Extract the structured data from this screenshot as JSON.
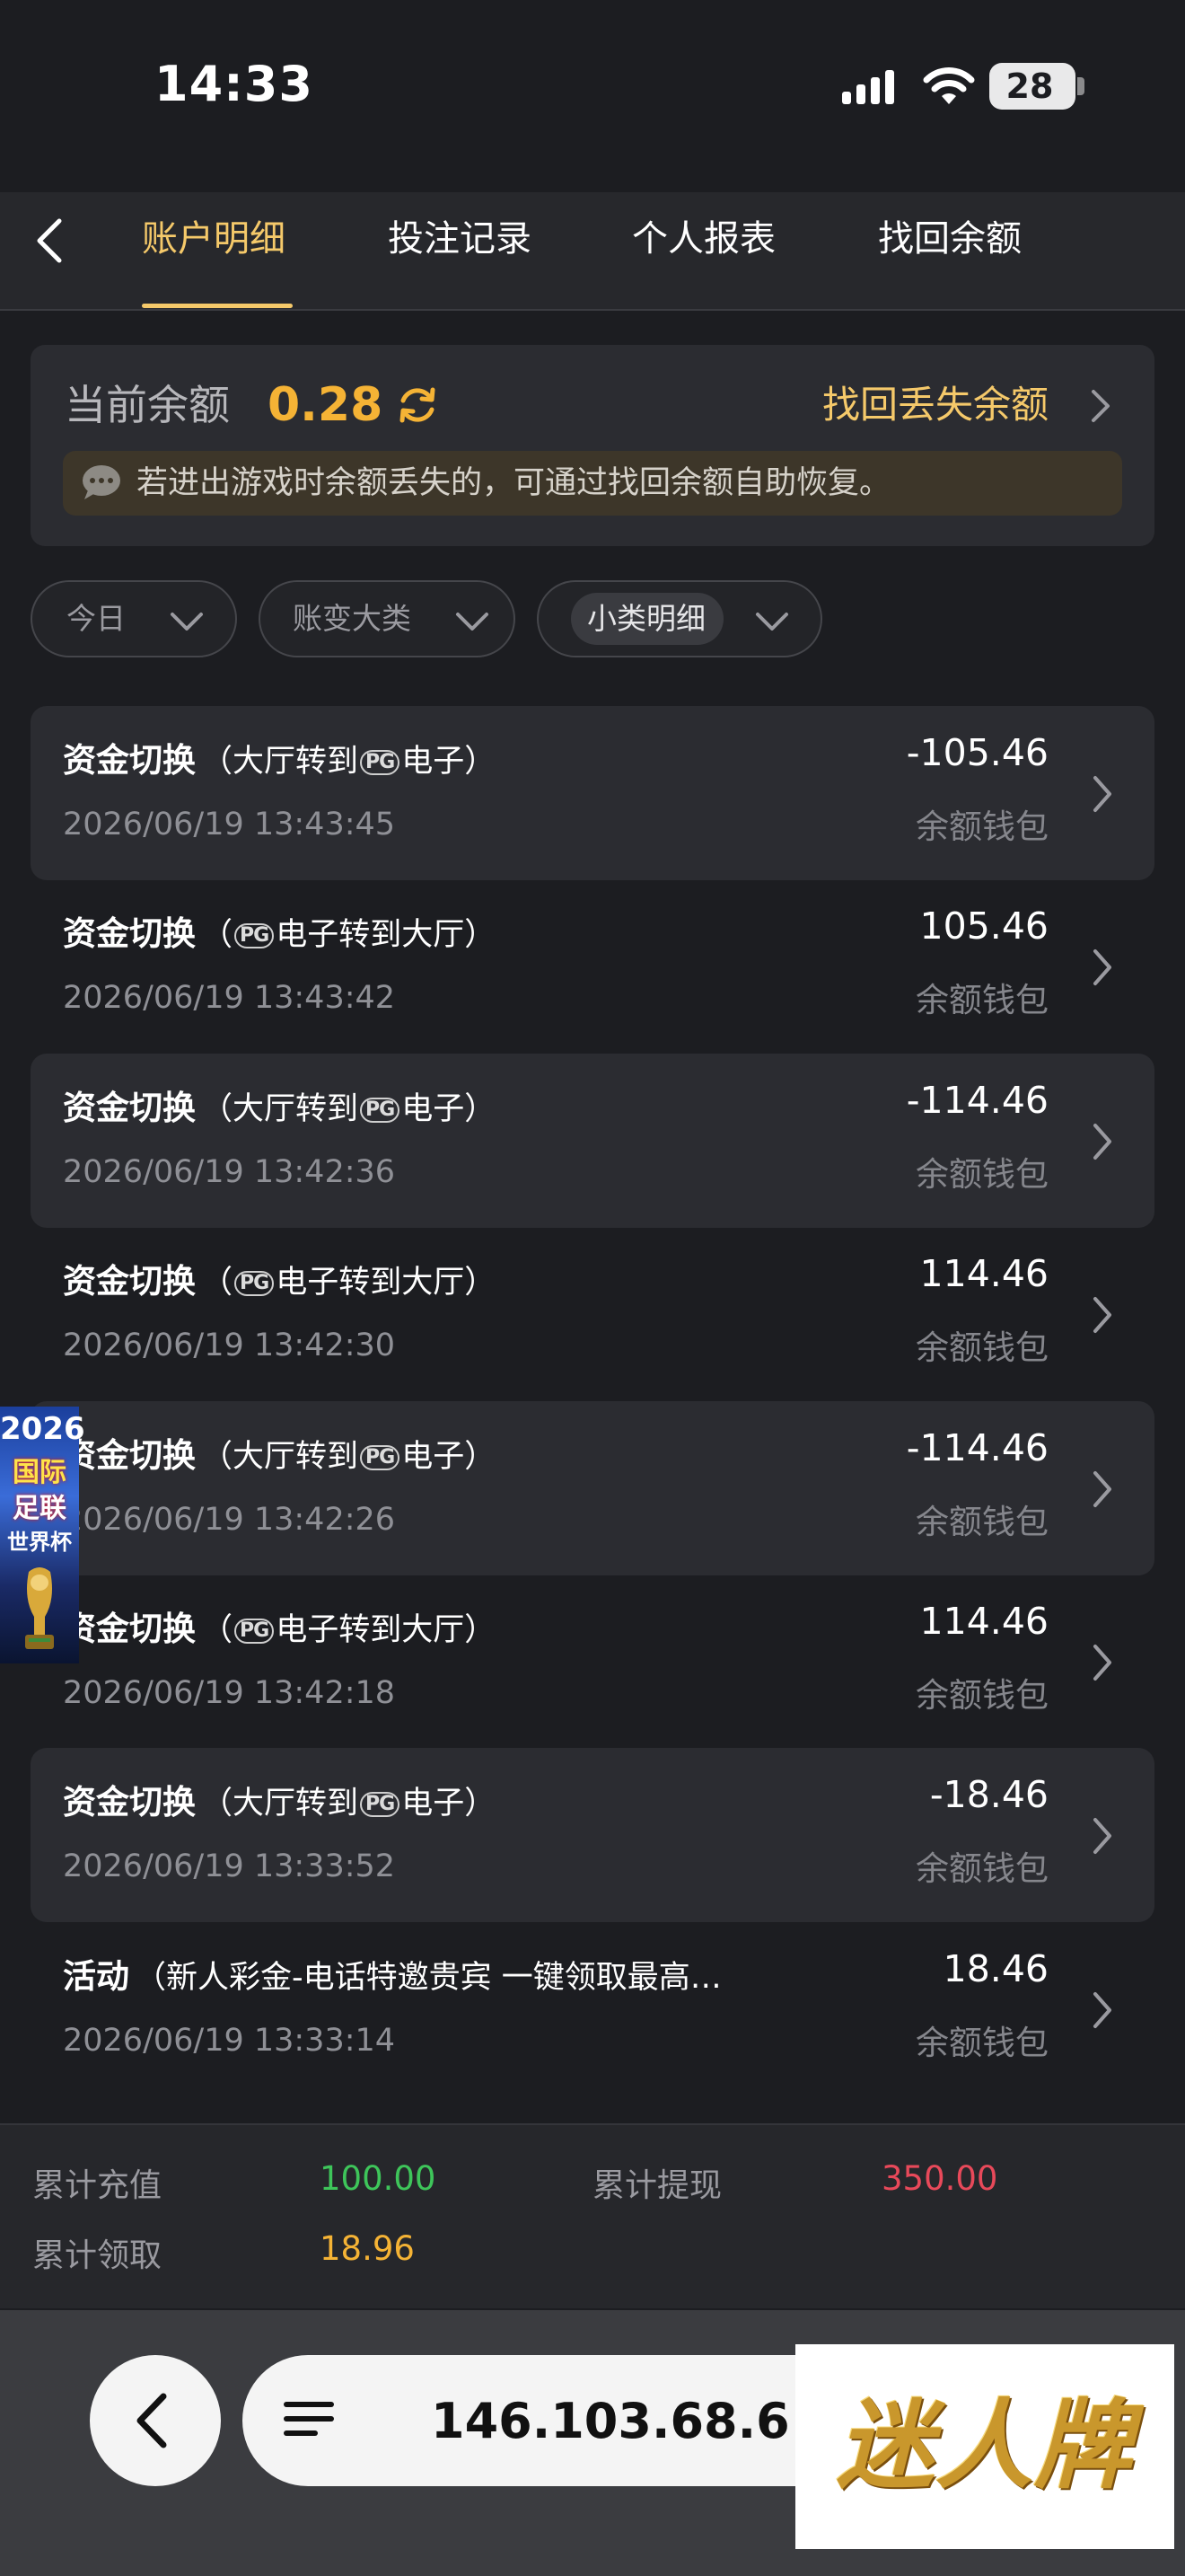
{
  "status_bar": {
    "time": "14:33",
    "battery": "28"
  },
  "nav": {
    "tabs": [
      {
        "label": "账户明细",
        "active": true
      },
      {
        "label": "投注记录",
        "active": false
      },
      {
        "label": "个人报表",
        "active": false
      },
      {
        "label": "找回余额",
        "active": false
      }
    ]
  },
  "balance": {
    "label": "当前余额",
    "value": "0.28",
    "recover_link": "找回丢失余额",
    "notice": "若进出游戏时余额丢失的，可通过找回余额自助恢复。"
  },
  "filters": {
    "date": "今日",
    "category": "账变大类",
    "subcategory": "小类明细"
  },
  "records": [
    {
      "title": "资金切换",
      "desc_pre": "（大厅转到",
      "desc_post": "电子）",
      "pg": "PG",
      "pg_position": "end",
      "time": "2026/06/19 13:43:45",
      "amount": "-105.46",
      "wallet": "余额钱包"
    },
    {
      "title": "资金切换",
      "desc_pre": "（",
      "desc_post": "电子转到大厅）",
      "pg": "PG",
      "pg_position": "start",
      "time": "2026/06/19 13:43:42",
      "amount": "105.46",
      "wallet": "余额钱包"
    },
    {
      "title": "资金切换",
      "desc_pre": "（大厅转到",
      "desc_post": "电子）",
      "pg": "PG",
      "pg_position": "end",
      "time": "2026/06/19 13:42:36",
      "amount": "-114.46",
      "wallet": "余额钱包"
    },
    {
      "title": "资金切换",
      "desc_pre": "（",
      "desc_post": "电子转到大厅）",
      "pg": "PG",
      "pg_position": "start",
      "time": "2026/06/19 13:42:30",
      "amount": "114.46",
      "wallet": "余额钱包"
    },
    {
      "title": "资金切换",
      "desc_pre": "（大厅转到",
      "desc_post": "电子）",
      "pg": "PG",
      "pg_position": "end",
      "time": "2026/06/19 13:42:26",
      "amount": "-114.46",
      "wallet": "余额钱包"
    },
    {
      "title": "资金切换",
      "desc_pre": "（",
      "desc_post": "电子转到大厅）",
      "pg": "PG",
      "pg_position": "start",
      "time": "2026/06/19 13:42:18",
      "amount": "114.46",
      "wallet": "余额钱包"
    },
    {
      "title": "资金切换",
      "desc_pre": "（大厅转到",
      "desc_post": "电子）",
      "pg": "PG",
      "pg_position": "end",
      "time": "2026/06/19 13:33:52",
      "amount": "-18.46",
      "wallet": "余额钱包"
    },
    {
      "title": "活动",
      "desc_pre": "（新人彩金-电话特邀贵宾 一键领取最高…",
      "desc_post": "",
      "pg": "",
      "pg_position": "none",
      "time": "2026/06/19 13:33:14",
      "amount": "18.46",
      "wallet": "余额钱包"
    }
  ],
  "float_ad": {
    "year": "2026",
    "line1": "国际",
    "line2": "足联",
    "line3": "世界杯"
  },
  "summary": {
    "recharge_label": "累计充值",
    "recharge_value": "100.00",
    "withdraw_label": "累计提现",
    "withdraw_value": "350.00",
    "claim_label": "累计领取",
    "claim_value": "18.96"
  },
  "browser": {
    "url": "146.103.68.6",
    "brand": "迷人牌"
  },
  "colors": {
    "accent_gold": "#f5c96a",
    "balance_orange": "#f5b335",
    "positive_green": "#3ec55a",
    "negative_red": "#e8495a",
    "background": "#1c1d21"
  }
}
